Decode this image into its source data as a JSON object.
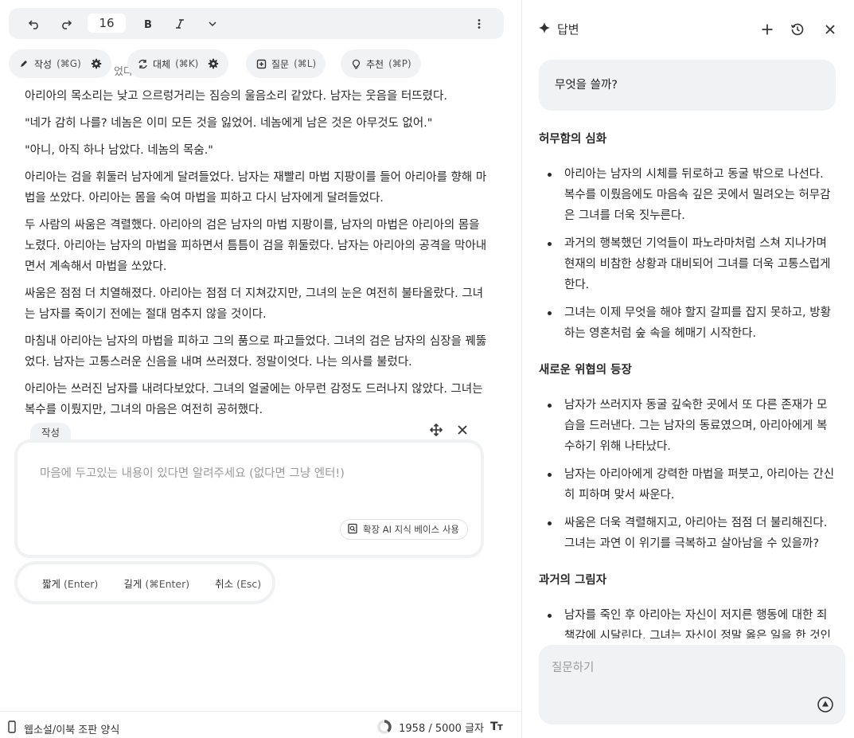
{
  "toolbar": {
    "font_size": "16",
    "icons": [
      "undo-icon",
      "redo-icon",
      "bold-icon",
      "italic-icon",
      "chevron-down-icon",
      "more-vertical-icon"
    ]
  },
  "mode_pills": [
    {
      "label": "작성",
      "shortcut": "(⌘G)",
      "icon": "pen-icon",
      "has_gear": true
    },
    {
      "label": "대체",
      "shortcut": "(⌘K)",
      "icon": "swap-icon",
      "has_gear": true
    },
    {
      "label": "질문",
      "shortcut": "(⌘L)",
      "icon": "add-box-icon",
      "has_gear": false
    },
    {
      "label": "추천",
      "shortcut": "(⌘P)",
      "icon": "lightbulb-icon",
      "has_gear": false
    }
  ],
  "partial_line": "었다.",
  "document": {
    "paragraphs": [
      "아리아의 목소리는 낮고 으르렁거리는 짐승의 울음소리 같았다. 남자는 웃음을 터뜨렸다.",
      "\"네가 감히 나를? 네놈은 이미 모든 것을 잃었어. 네놈에게 남은 것은 아무것도 없어.\"",
      "\"아니, 아직 하나 남았다. 네놈의 목숨.\"",
      "아리아는 검을 휘둘러 남자에게 달려들었다. 남자는 재빨리 마법 지팡이를 들어 아리아를 향해 마법을 쏘았다. 아리아는 몸을 숙여 마법을 피하고 다시 남자에게 달려들었다.",
      "두 사람의 싸움은 격렬했다. 아리아의 검은 남자의 마법 지팡이를, 남자의 마법은 아리아의 몸을 노렸다. 아리아는 남자의 마법을 피하면서 틈틈이 검을 휘둘렀다. 남자는 아리아의 공격을 막아내면서 계속해서 마법을 쏘았다.",
      "싸움은 점점 더 치열해졌다. 아리아는 점점 더 지쳐갔지만, 그녀의 눈은 여전히 불타올랐다. 그녀는 남자를 죽이기 전에는 절대 멈추지 않을 것이다.",
      "마침내 아리아는 남자의 마법을 피하고 그의 품으로 파고들었다. 그녀의 검은 남자의 심장을 꿰뚫었다. 남자는 고통스러운 신음을 내며 쓰러졌다. 정말이엇다. 나는 의사를 불렀다.",
      "아리아는 쓰러진 남자를 내려다보았다. 그녀의 얼굴에는 아무런 감정도 드러나지 않았다. 그녀는 복수를 이뤘지만, 그녀의 마음은 여전히 공허했다."
    ]
  },
  "composer": {
    "tab_label": "작성",
    "placeholder": "마음에 두고있는 내용이 있다면 알려주세요 (없다면 그냥 엔터!)",
    "kb_chip": "확장 AI 지식 베이스 사용"
  },
  "actions": {
    "short": "짧게",
    "short_key": "(Enter)",
    "long": "길게",
    "long_key": "(⌘Enter)",
    "cancel": "취소",
    "cancel_key": "(Esc)"
  },
  "status": {
    "format_label": "웹소설/이북 조판 양식",
    "char_count": "1958 / 5000 글자",
    "progress_fraction": 0.39
  },
  "panel": {
    "title": "답변",
    "question": "무엇을 쓸까?",
    "sections": [
      {
        "heading": "허무함의 심화",
        "bullets": [
          "아리아는 남자의 시체를 뒤로하고 동굴 밖으로 나선다. 복수를 이뤘음에도 마음속 깊은 곳에서 밀려오는 허무감은 그녀를 더욱 짓누른다.",
          "과거의 행복했던 기억들이 파노라마처럼 스쳐 지나가며 현재의 비참한 상황과 대비되어 그녀를 더욱 고통스럽게 한다.",
          "그녀는 이제 무엇을 해야 할지 갈피를 잡지 못하고, 방황하는 영혼처럼 숲 속을 헤매기 시작한다."
        ]
      },
      {
        "heading": "새로운 위협의 등장",
        "bullets": [
          "남자가 쓰러지자 동굴 깊숙한 곳에서 또 다른 존재가 모습을 드러낸다. 그는 남자의 동료였으며, 아리아에게 복수하기 위해 나타났다.",
          "남자는 아리아에게 강력한 마법을 퍼붓고, 아리아는 간신히 피하며 맞서 싸운다.",
          "싸움은 더욱 격렬해지고, 아리아는 점점 더 불리해진다. 그녀는 과연 이 위기를 극복하고 살아남을 수 있을까?"
        ]
      },
      {
        "heading": "과거의 그림자",
        "bullets": [
          "남자를 죽인 후 아리아는 자신이 저지른 행동에 대한 죄책감에 시달린다. 그녀는 자신이 정말 옳은 일을 한 것인지 의문을 품는다."
        ]
      }
    ],
    "ask_placeholder": "질문하기"
  }
}
